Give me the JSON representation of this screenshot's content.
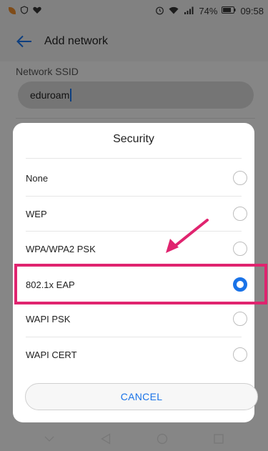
{
  "status_bar": {
    "battery": "74%",
    "time": "09:58"
  },
  "app_bar": {
    "title": "Add network"
  },
  "form": {
    "ssid_label": "Network SSID",
    "ssid_value": "eduroam"
  },
  "dialog": {
    "title": "Security",
    "options": [
      {
        "label": "None",
        "selected": false
      },
      {
        "label": "WEP",
        "selected": false
      },
      {
        "label": "WPA/WPA2 PSK",
        "selected": false
      },
      {
        "label": "802.1x EAP",
        "selected": true
      },
      {
        "label": "WAPI PSK",
        "selected": false
      },
      {
        "label": "WAPI CERT",
        "selected": false
      }
    ],
    "cancel_label": "CANCEL"
  },
  "colors": {
    "accent": "#1a73e8",
    "highlight": "#e0246f"
  },
  "icons": {
    "back": "arrow-left-icon",
    "nav_back": "triangle-back-icon",
    "nav_home": "circle-home-icon",
    "nav_recent": "square-recent-icon",
    "nav_collapse": "chevron-down-icon"
  }
}
